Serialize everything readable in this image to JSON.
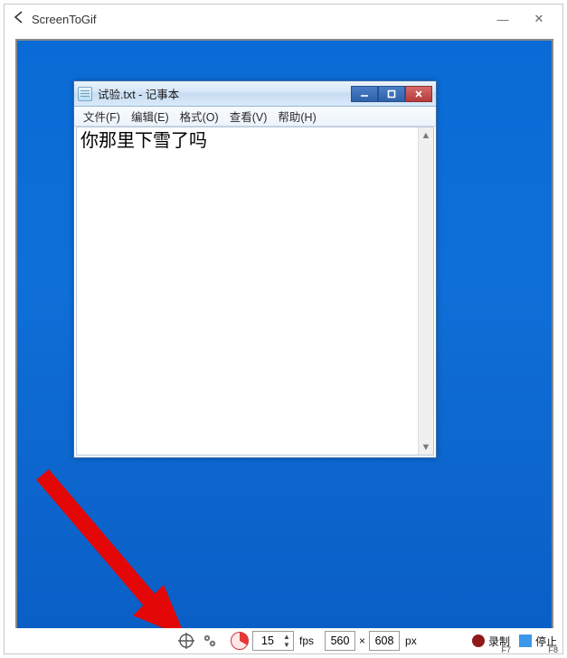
{
  "app": {
    "title": "ScreenToGif",
    "window_buttons": {
      "minimize": "—",
      "close": "✕"
    }
  },
  "notepad": {
    "title": "试验.txt - 记事本",
    "menu": {
      "file": "文件(F)",
      "edit": "编辑(E)",
      "format": "格式(O)",
      "view": "查看(V)",
      "help": "帮助(H)"
    },
    "content": "你那里下雪了吗"
  },
  "toolbar": {
    "fps_value": "15",
    "fps_label": "fps",
    "width_value": "560",
    "height_value": "608",
    "px_label": "px",
    "times": "×",
    "record": {
      "label": "录制",
      "shortcut": "F7"
    },
    "stop": {
      "label": "停止",
      "shortcut": "F8"
    }
  }
}
